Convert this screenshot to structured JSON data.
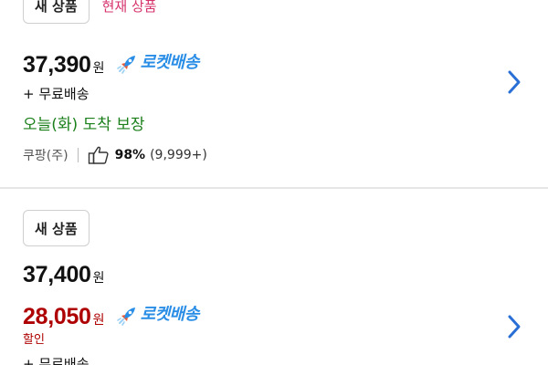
{
  "offers": [
    {
      "badge": "새 상품",
      "current_tag": "현재 상품",
      "price": "37,390",
      "currency": "원",
      "rocket_label": "로켓배송",
      "shipping": "+ 무료배송",
      "arrival": "오늘(화) 도착 보장",
      "seller": "쿠팡(주)",
      "rating_percent": "98%",
      "rating_count": "(9,999+)"
    },
    {
      "badge": "새 상품",
      "original_price": "37,400",
      "price": "28,050",
      "currency": "원",
      "rocket_label": "로켓배송",
      "discount_label": "할인",
      "shipping": "+ 무료배송"
    }
  ],
  "colors": {
    "accent_blue": "#2a8ee6",
    "sale_red": "#ae0000",
    "arrival_green": "#1a7f1a",
    "current_pink": "#d6336c"
  },
  "icons": [
    "rocket-icon",
    "thumbs-up-icon",
    "chevron-right-icon"
  ]
}
